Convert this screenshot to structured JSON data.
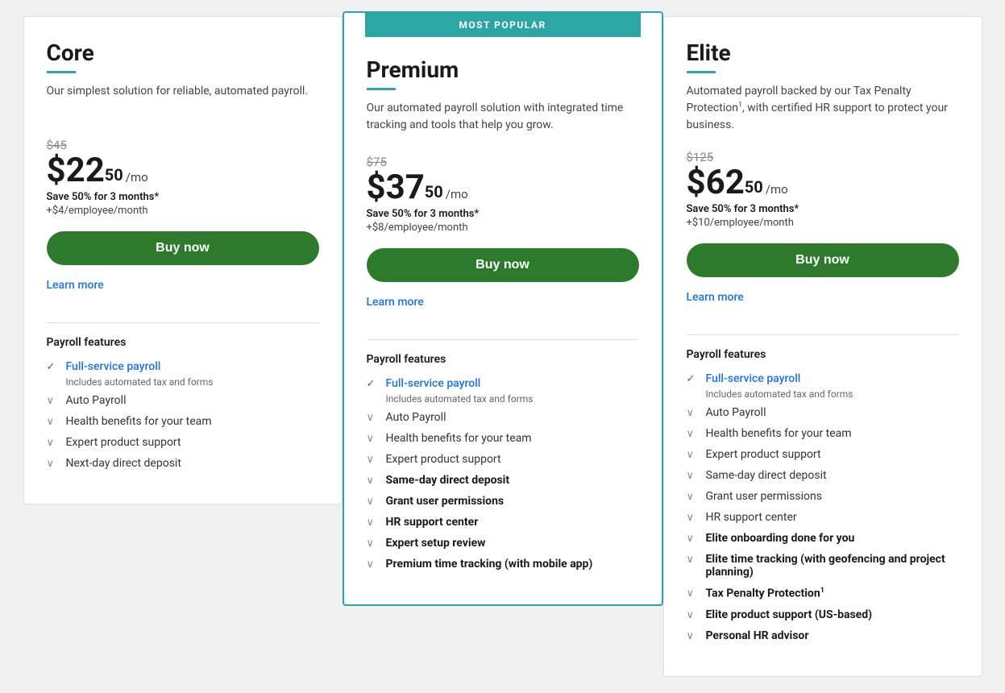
{
  "plans": [
    {
      "id": "core",
      "name": "Core",
      "description": "Our simplest solution for reliable, automated payroll.",
      "original_price": "$45",
      "price_main": "$22",
      "price_cents": "50",
      "price_per": "/mo",
      "save_text": "Save 50% for 3 months*",
      "per_employee": "+$4/employee/month",
      "buy_label": "Buy now",
      "learn_more": "Learn more",
      "is_popular": false,
      "popular_label": "",
      "features_label": "Payroll features",
      "features": [
        {
          "type": "check",
          "text": "Full-service payroll",
          "highlight": true,
          "sub": "Includes automated tax and forms"
        },
        {
          "type": "chevron",
          "text": "Auto Payroll"
        },
        {
          "type": "chevron",
          "text": "Health benefits for your team"
        },
        {
          "type": "chevron",
          "text": "Expert product support"
        },
        {
          "type": "chevron",
          "text": "Next-day direct deposit"
        }
      ]
    },
    {
      "id": "premium",
      "name": "Premium",
      "description": "Our automated payroll solution with integrated time tracking and tools that help you grow.",
      "original_price": "$75",
      "price_main": "$37",
      "price_cents": "50",
      "price_per": "/mo",
      "save_text": "Save 50% for 3 months*",
      "per_employee": "+$8/employee/month",
      "buy_label": "Buy now",
      "learn_more": "Learn more",
      "is_popular": true,
      "popular_label": "MOST POPULAR",
      "features_label": "Payroll features",
      "features": [
        {
          "type": "check",
          "text": "Full-service payroll",
          "highlight": true,
          "sub": "Includes automated tax and forms"
        },
        {
          "type": "chevron",
          "text": "Auto Payroll"
        },
        {
          "type": "chevron",
          "text": "Health benefits for your team"
        },
        {
          "type": "chevron",
          "text": "Expert product support"
        },
        {
          "type": "chevron",
          "text": "Same-day direct deposit",
          "bold": true
        },
        {
          "type": "chevron",
          "text": "Grant user permissions",
          "bold": true
        },
        {
          "type": "chevron",
          "text": "HR support center",
          "bold": true
        },
        {
          "type": "chevron",
          "text": "Expert setup review",
          "bold": true
        },
        {
          "type": "chevron",
          "text": "Premium time tracking (with mobile app)",
          "bold": true
        }
      ]
    },
    {
      "id": "elite",
      "name": "Elite",
      "description": "Automated payroll backed by our Tax Penalty Protection",
      "description_sup": "1",
      "description_end": ", with certified HR support to protect your business.",
      "original_price": "$125",
      "price_main": "$62",
      "price_cents": "50",
      "price_per": "/mo",
      "save_text": "Save 50% for 3 months*",
      "per_employee": "+$10/employee/month",
      "buy_label": "Buy now",
      "learn_more": "Learn more",
      "is_popular": false,
      "popular_label": "",
      "features_label": "Payroll features",
      "features": [
        {
          "type": "check",
          "text": "Full-service payroll",
          "highlight": true,
          "sub": "Includes automated tax and forms"
        },
        {
          "type": "chevron",
          "text": "Auto Payroll"
        },
        {
          "type": "chevron",
          "text": "Health benefits for your team"
        },
        {
          "type": "chevron",
          "text": "Expert product support"
        },
        {
          "type": "chevron",
          "text": "Same-day direct deposit"
        },
        {
          "type": "chevron",
          "text": "Grant user permissions"
        },
        {
          "type": "chevron",
          "text": "HR support center"
        },
        {
          "type": "chevron",
          "text": "Elite onboarding done for you",
          "bold": true
        },
        {
          "type": "chevron",
          "text": "Elite time tracking (with geofencing and project planning)",
          "bold": true
        },
        {
          "type": "chevron",
          "text": "Tax Penalty Protection",
          "bold": true,
          "sup": "1"
        },
        {
          "type": "chevron",
          "text": "Elite product support (US-based)",
          "bold": true
        },
        {
          "type": "chevron",
          "text": "Personal HR advisor",
          "bold": true
        }
      ]
    }
  ]
}
